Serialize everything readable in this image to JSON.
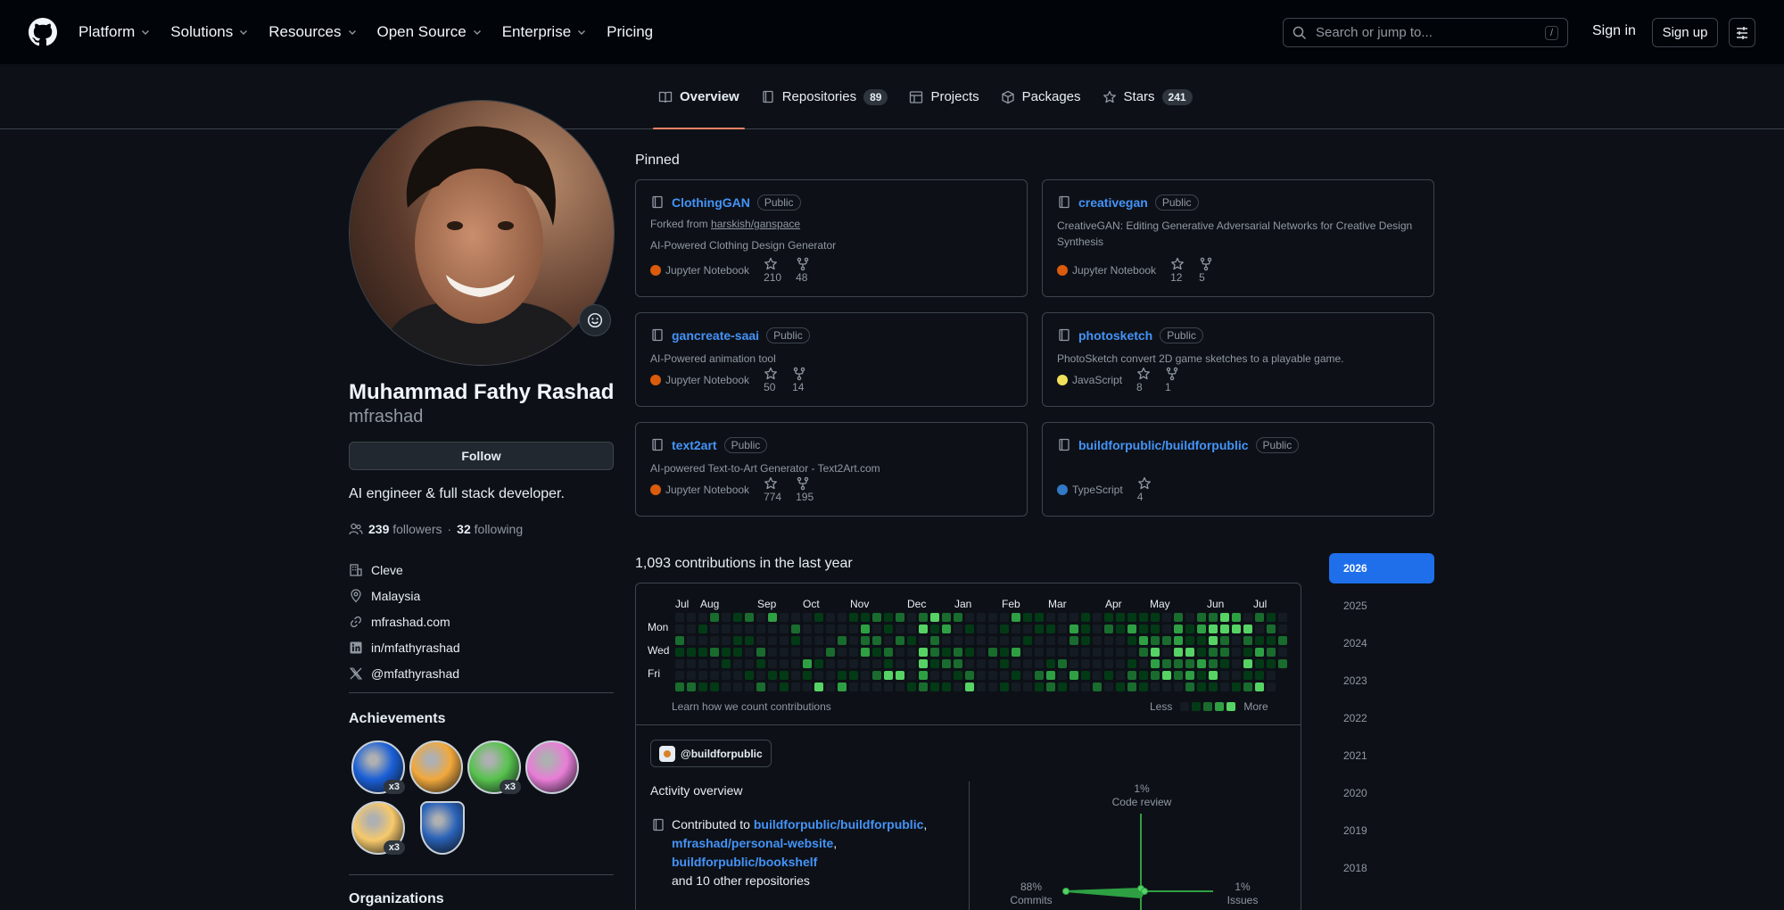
{
  "header": {
    "nav": [
      {
        "label": "Platform",
        "dropdown": true
      },
      {
        "label": "Solutions",
        "dropdown": true
      },
      {
        "label": "Resources",
        "dropdown": true
      },
      {
        "label": "Open Source",
        "dropdown": true
      },
      {
        "label": "Enterprise",
        "dropdown": true
      },
      {
        "label": "Pricing",
        "dropdown": false
      }
    ],
    "search_placeholder": "Search or jump to...",
    "search_shortcut": "/",
    "signin": "Sign in",
    "signup": "Sign up"
  },
  "tabs": [
    {
      "label": "Overview",
      "icon": "book-icon",
      "count": "",
      "active": true
    },
    {
      "label": "Repositories",
      "icon": "repo-icon",
      "count": "89",
      "active": false
    },
    {
      "label": "Projects",
      "icon": "table-icon",
      "count": "",
      "active": false
    },
    {
      "label": "Packages",
      "icon": "package-icon",
      "count": "",
      "active": false
    },
    {
      "label": "Stars",
      "icon": "star-icon",
      "count": "241",
      "active": false
    }
  ],
  "profile": {
    "fullname": "Muhammad Fathy Rashad",
    "username": "mfrashad",
    "follow": "Follow",
    "bio": "AI engineer & full stack developer.",
    "followers": "239",
    "followers_label": "followers",
    "sep": "·",
    "following": "32",
    "following_label": "following",
    "details": [
      {
        "icon": "organization-icon",
        "text": "Cleve"
      },
      {
        "icon": "location-icon",
        "text": "Malaysia"
      },
      {
        "icon": "link-icon",
        "text": "mfrashad.com"
      },
      {
        "icon": "linkedin-icon",
        "text": "in/mfathyrashad"
      },
      {
        "icon": "x-twitter-icon",
        "text": "@mfathyrashad"
      }
    ],
    "achievements_title": "Achievements",
    "achievements": [
      {
        "name": "pull-shark-badge",
        "count": "x3",
        "color": "#1a5fd6"
      },
      {
        "name": "starstruck-badge",
        "count": "",
        "color": "#f2a83b"
      },
      {
        "name": "pair-extraordinaire-badge",
        "count": "x3",
        "color": "#57c24d"
      },
      {
        "name": "yolo-badge",
        "count": "",
        "color": "#e87dd6"
      },
      {
        "name": "quickdraw-badge",
        "count": "x3",
        "color": "#f7c96b"
      },
      {
        "name": "arctic-code-vault-badge",
        "count": "",
        "color": "#2a62b8"
      }
    ],
    "organizations_title": "Organizations"
  },
  "pinned": {
    "title": "Pinned",
    "cards": [
      {
        "name": "ClothingGAN",
        "visibility": "Public",
        "forked_prefix": "Forked from ",
        "forked_from": "harskish/ganspace",
        "description": "AI-Powered Clothing Design Generator",
        "language": "Jupyter Notebook",
        "lang_color": "#DA5B0B",
        "stars": "210",
        "forks": "48"
      },
      {
        "name": "creativegan",
        "visibility": "Public",
        "forked_prefix": "",
        "forked_from": "",
        "description": "CreativeGAN: Editing Generative Adversarial Networks for Creative Design Synthesis",
        "language": "Jupyter Notebook",
        "lang_color": "#DA5B0B",
        "stars": "12",
        "forks": "5"
      },
      {
        "name": "gancreate-saai",
        "visibility": "Public",
        "forked_prefix": "",
        "forked_from": "",
        "description": "AI-Powered animation tool",
        "language": "Jupyter Notebook",
        "lang_color": "#DA5B0B",
        "stars": "50",
        "forks": "14"
      },
      {
        "name": "photosketch",
        "visibility": "Public",
        "forked_prefix": "",
        "forked_from": "",
        "description": "PhotoSketch convert 2D game sketches to a playable game.",
        "language": "JavaScript",
        "lang_color": "#f1e05a",
        "stars": "8",
        "forks": "1"
      },
      {
        "name": "text2art",
        "visibility": "Public",
        "forked_prefix": "",
        "forked_from": "",
        "description": "AI-powered Text-to-Art Generator - Text2Art.com",
        "language": "Jupyter Notebook",
        "lang_color": "#DA5B0B",
        "stars": "774",
        "forks": "195"
      },
      {
        "name": "buildforpublic/buildforpublic",
        "visibility": "Public",
        "forked_prefix": "",
        "forked_from": "",
        "description": "",
        "language": "TypeScript",
        "lang_color": "#3178c6",
        "stars": "4",
        "forks": ""
      }
    ]
  },
  "contributions": {
    "title": "1,093 contributions in the last year",
    "months": [
      "Jul",
      "Aug",
      "Sep",
      "Oct",
      "Nov",
      "Dec",
      "Jan",
      "Feb",
      "Mar",
      "Apr",
      "May",
      "Jun",
      "Jul"
    ],
    "days": [
      "Mon",
      "Wed",
      "Fri"
    ],
    "learn_link": "Learn how we count contributions",
    "less": "Less",
    "more": "More",
    "level_colors": [
      "#151b23",
      "#033a16",
      "#196c2e",
      "#2ea043",
      "#56d364"
    ]
  },
  "activity": {
    "org": "@buildforpublic",
    "title": "Activity overview",
    "prefix": "Contributed to ",
    "repo1": "buildforpublic/buildforpublic",
    "comma1": ",",
    "repo2": "mfrashad/personal-website",
    "comma2": ",",
    "repo3": "buildforpublic/bookshelf",
    "suffix": "and 10 other repositories",
    "radar": {
      "code_review_pct": "1%",
      "code_review_label": "Code review",
      "commits_pct": "88%",
      "commits_label": "Commits",
      "issues_pct": "1%",
      "issues_label": "Issues"
    }
  },
  "years": [
    "2026",
    "2025",
    "2024",
    "2023",
    "2022",
    "2021",
    "2020",
    "2019",
    "2018"
  ]
}
